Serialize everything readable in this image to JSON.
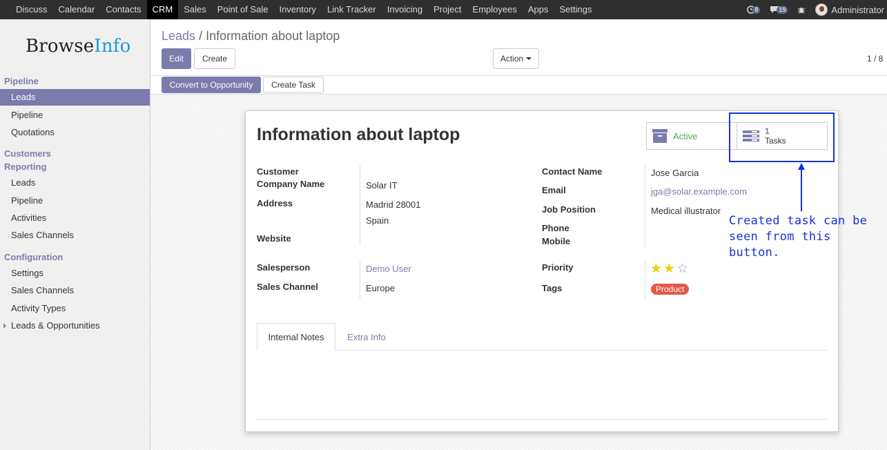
{
  "topbar": {
    "menu": [
      "Discuss",
      "Calendar",
      "Contacts",
      "CRM",
      "Sales",
      "Point of Sale",
      "Inventory",
      "Link Tracker",
      "Invoicing",
      "Project",
      "Employees",
      "Apps",
      "Settings"
    ],
    "active": "CRM",
    "messages_count": "8",
    "chat_count": "19",
    "user": "Administrator"
  },
  "brand": {
    "part1": "Browse",
    "part2": "Info"
  },
  "sidebar": {
    "pipeline_header": "Pipeline",
    "pipeline_items": [
      "Leads",
      "Pipeline",
      "Quotations"
    ],
    "customers_header": "Customers",
    "reporting_header": "Reporting",
    "reporting_items": [
      "Leads",
      "Pipeline",
      "Activities",
      "Sales Channels"
    ],
    "configuration_header": "Configuration",
    "configuration_items": [
      "Settings",
      "Sales Channels",
      "Activity Types",
      "Leads & Opportunities"
    ]
  },
  "breadcrumb": {
    "parent": "Leads",
    "sep": "/",
    "current": "Information about laptop"
  },
  "buttons": {
    "edit": "Edit",
    "create": "Create",
    "action": "Action",
    "convert": "Convert to Opportunity",
    "create_task": "Create Task"
  },
  "pager": "1 / 8",
  "form": {
    "title": "Information about laptop",
    "active_label": "Active",
    "tasks_count": "1",
    "tasks_label": "Tasks",
    "labels": {
      "customer": "Customer",
      "company_name": "Company Name",
      "address": "Address",
      "website": "Website",
      "salesperson": "Salesperson",
      "sales_channel": "Sales Channel",
      "contact_name": "Contact Name",
      "email": "Email",
      "job_position": "Job Position",
      "phone": "Phone",
      "mobile": "Mobile",
      "priority": "Priority",
      "tags": "Tags"
    },
    "values": {
      "company_name": "Solar IT",
      "address_line1": "Madrid 28001",
      "address_line2": "Spain",
      "salesperson": "Demo User",
      "sales_channel": "Europe",
      "contact_name": "Jose Garcia",
      "email": "jga@solar.example.com",
      "job_position": "Medical illustrator",
      "priority_stars": 2,
      "priority_max": 3,
      "tag": "Product"
    },
    "tabs": [
      "Internal Notes",
      "Extra Info"
    ]
  },
  "annotation": {
    "line1": "Created task can be",
    "line2": "seen from this button."
  },
  "colors": {
    "accent": "#7c7bad",
    "annotation": "#1731d8",
    "tag": "#e5574a",
    "active_green": "#4caf50",
    "star": "#f3cc00"
  }
}
